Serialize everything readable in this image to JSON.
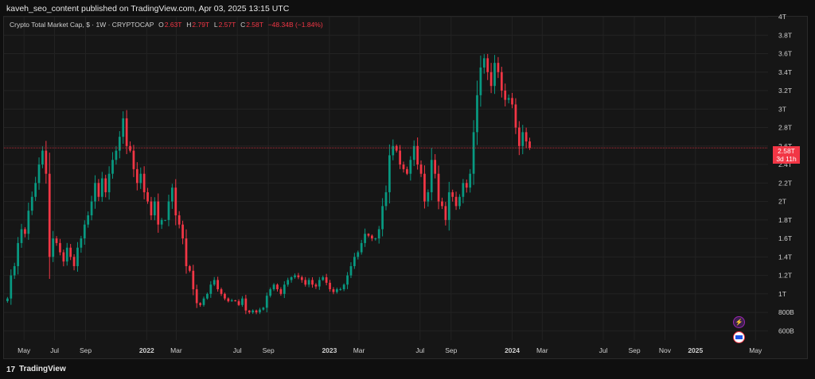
{
  "header": {
    "publisher": "kaveh_seo_content published on TradingView.com, Apr 03, 2025 13:15 UTC"
  },
  "legend": {
    "symbol": "Crypto Total Market Cap, $ · 1W · CRYPTOCAP",
    "o_label": "O",
    "o_value": "2.63T",
    "h_label": "H",
    "h_value": "2.79T",
    "l_label": "L",
    "l_value": "2.57T",
    "c_label": "C",
    "c_value": "2.58T",
    "change": "−48.34B (−1.84%)"
  },
  "price_tag": {
    "value": "2.58T",
    "countdown": "3d 11h"
  },
  "footer": {
    "brand": "TradingView",
    "logo_glyph": "17"
  },
  "colors": {
    "up": "#089981",
    "down": "#f23645",
    "background": "#161616",
    "grid": "#232323"
  },
  "icons": [
    "lightning-icon",
    "flag-icon",
    "tradingview-logo-icon"
  ],
  "chart_data": {
    "type": "candlestick",
    "title": "",
    "xlabel": "",
    "ylabel": "",
    "y_unit": "USD (trillions)",
    "ylim": [
      0.5,
      4.0
    ],
    "yticks": [
      {
        "v": 4.0,
        "label": "4T"
      },
      {
        "v": 3.8,
        "label": "3.8T"
      },
      {
        "v": 3.6,
        "label": "3.6T"
      },
      {
        "v": 3.4,
        "label": "3.4T"
      },
      {
        "v": 3.2,
        "label": "3.2T"
      },
      {
        "v": 3.0,
        "label": "3T"
      },
      {
        "v": 2.8,
        "label": "2.8T"
      },
      {
        "v": 2.6,
        "label": "2.6T"
      },
      {
        "v": 2.4,
        "label": "2.4T"
      },
      {
        "v": 2.2,
        "label": "2.2T"
      },
      {
        "v": 2.0,
        "label": "2T"
      },
      {
        "v": 1.8,
        "label": "1.8T"
      },
      {
        "v": 1.6,
        "label": "1.6T"
      },
      {
        "v": 1.4,
        "label": "1.4T"
      },
      {
        "v": 1.2,
        "label": "1.2T"
      },
      {
        "v": 1.0,
        "label": "1T"
      },
      {
        "v": 0.8,
        "label": "800B"
      },
      {
        "v": 0.6,
        "label": "600B"
      }
    ],
    "xlim": [
      "2021-03-22",
      "2025-05-26"
    ],
    "xticks": [
      {
        "date": "2021-05-01",
        "label": "May",
        "bold": false
      },
      {
        "date": "2021-07-01",
        "label": "Jul",
        "bold": false
      },
      {
        "date": "2021-09-01",
        "label": "Sep",
        "bold": false
      },
      {
        "date": "2022-01-01",
        "label": "2022",
        "bold": true
      },
      {
        "date": "2022-03-01",
        "label": "Mar",
        "bold": false
      },
      {
        "date": "2022-07-01",
        "label": "Jul",
        "bold": false
      },
      {
        "date": "2022-09-01",
        "label": "Sep",
        "bold": false
      },
      {
        "date": "2023-01-01",
        "label": "2023",
        "bold": true
      },
      {
        "date": "2023-03-01",
        "label": "Mar",
        "bold": false
      },
      {
        "date": "2023-07-01",
        "label": "Jul",
        "bold": false
      },
      {
        "date": "2023-09-01",
        "label": "Sep",
        "bold": false
      },
      {
        "date": "2024-01-01",
        "label": "2024",
        "bold": true
      },
      {
        "date": "2024-03-01",
        "label": "Mar",
        "bold": false
      },
      {
        "date": "2024-07-01",
        "label": "Jul",
        "bold": false
      },
      {
        "date": "2024-09-01",
        "label": "Sep",
        "bold": false
      },
      {
        "date": "2024-11-01",
        "label": "Nov",
        "bold": false
      },
      {
        "date": "2025-01-01",
        "label": "2025",
        "bold": true
      },
      {
        "date": "2025-05-01",
        "label": "May",
        "bold": false
      }
    ],
    "current_price": 2.58,
    "first_week": "2021-03-29",
    "interval_days": 7,
    "closes": [
      0.95,
      1.2,
      1.3,
      1.55,
      1.7,
      1.65,
      1.9,
      2.05,
      2.2,
      2.4,
      2.55,
      2.3,
      1.4,
      1.6,
      1.55,
      1.45,
      1.35,
      1.5,
      1.4,
      1.3,
      1.5,
      1.6,
      1.75,
      1.85,
      2.0,
      2.2,
      2.05,
      2.25,
      2.1,
      2.3,
      2.45,
      2.55,
      2.7,
      2.9,
      2.6,
      2.55,
      2.35,
      2.2,
      2.3,
      2.1,
      2.0,
      1.85,
      2.0,
      1.75,
      1.8,
      1.8,
      2.0,
      2.15,
      1.85,
      1.75,
      1.6,
      1.3,
      1.25,
      1.05,
      0.9,
      0.88,
      0.95,
      1.0,
      1.1,
      1.15,
      1.05,
      1.0,
      0.95,
      0.92,
      0.93,
      0.92,
      0.88,
      0.95,
      0.82,
      0.8,
      0.82,
      0.8,
      0.83,
      0.85,
      0.98,
      1.05,
      1.1,
      1.05,
      1.0,
      1.1,
      1.15,
      1.18,
      1.2,
      1.18,
      1.15,
      1.1,
      1.15,
      1.1,
      1.08,
      1.15,
      1.18,
      1.12,
      1.05,
      1.02,
      1.05,
      1.05,
      1.1,
      1.2,
      1.3,
      1.4,
      1.45,
      1.55,
      1.65,
      1.63,
      1.6,
      1.6,
      1.7,
      1.95,
      2.1,
      2.5,
      2.6,
      2.55,
      2.4,
      2.35,
      2.3,
      2.45,
      2.6,
      2.4,
      2.3,
      2.0,
      2.1,
      2.45,
      2.3,
      2.0,
      1.95,
      1.8,
      2.1,
      2.05,
      1.95,
      2.05,
      2.2,
      2.15,
      2.3,
      2.75,
      3.15,
      3.45,
      3.55,
      3.4,
      3.25,
      3.5,
      3.4,
      3.2,
      3.1,
      3.12,
      3.05,
      2.8,
      2.6,
      2.75,
      2.65,
      2.58
    ]
  }
}
